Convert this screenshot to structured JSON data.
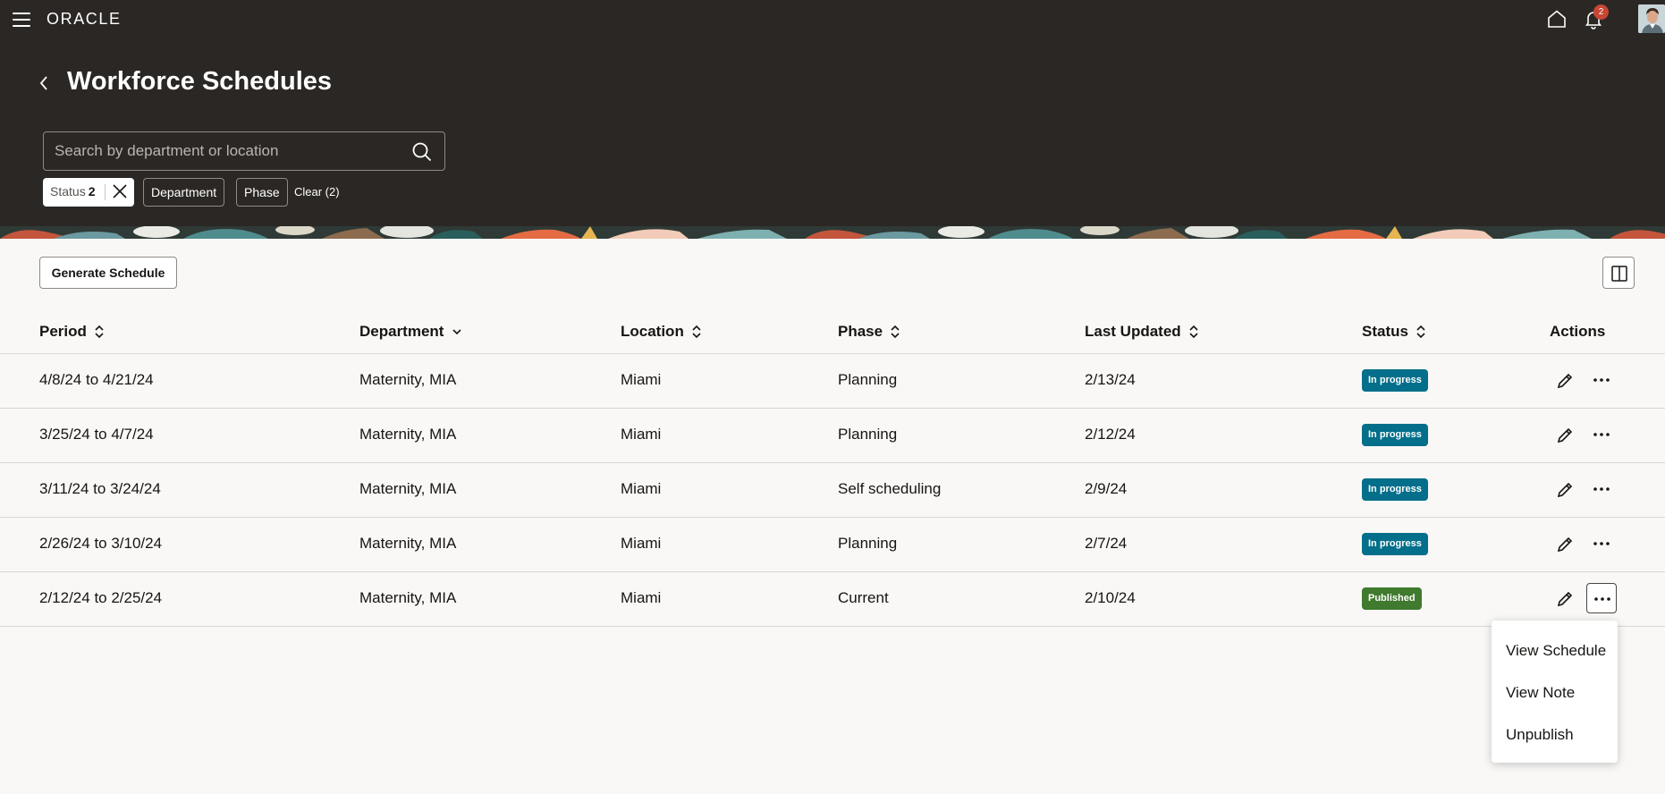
{
  "header": {
    "logo_text": "ORACLE",
    "notification_count": "2",
    "page_title": "Workforce Schedules"
  },
  "search": {
    "placeholder": "Search by department or location",
    "value": ""
  },
  "filters": {
    "status_label": "Status",
    "status_count": "2",
    "department_label": "Department",
    "phase_label": "Phase",
    "clear_label": "Clear (2)"
  },
  "toolbar": {
    "generate_label": "Generate Schedule"
  },
  "table": {
    "columns": [
      {
        "label": "Period",
        "icon": "sort-icon"
      },
      {
        "label": "Department",
        "icon": "chevron-down-icon"
      },
      {
        "label": "Location",
        "icon": "sort-icon"
      },
      {
        "label": "Phase",
        "icon": "sort-icon"
      },
      {
        "label": "Last Updated",
        "icon": "sort-icon"
      },
      {
        "label": "Status",
        "icon": "sort-icon"
      },
      {
        "label": "Actions",
        "icon": ""
      }
    ],
    "rows": [
      {
        "period": "4/8/24 to 4/21/24",
        "department": "Maternity, MIA",
        "location": "Miami",
        "phase": "Planning",
        "updated": "2/13/24",
        "status": "In progress"
      },
      {
        "period": "3/25/24 to 4/7/24",
        "department": "Maternity, MIA",
        "location": "Miami",
        "phase": "Planning",
        "updated": "2/12/24",
        "status": "In progress"
      },
      {
        "period": "3/11/24 to 3/24/24",
        "department": "Maternity, MIA",
        "location": "Miami",
        "phase": "Self scheduling",
        "updated": "2/9/24",
        "status": "In progress"
      },
      {
        "period": "2/26/24 to 3/10/24",
        "department": "Maternity, MIA",
        "location": "Miami",
        "phase": "Planning",
        "updated": "2/7/24",
        "status": "In progress"
      },
      {
        "period": "2/12/24 to 2/25/24",
        "department": "Maternity, MIA",
        "location": "Miami",
        "phase": "Current",
        "updated": "2/10/24",
        "status": "Published"
      }
    ]
  },
  "menu": {
    "items": [
      "View Schedule",
      "View Note",
      "Unpublish"
    ]
  },
  "colors": {
    "header_bg": "#2b2724",
    "in_progress": "#036f8a",
    "published": "#3f7a2e",
    "notification_badge": "#c74634"
  }
}
